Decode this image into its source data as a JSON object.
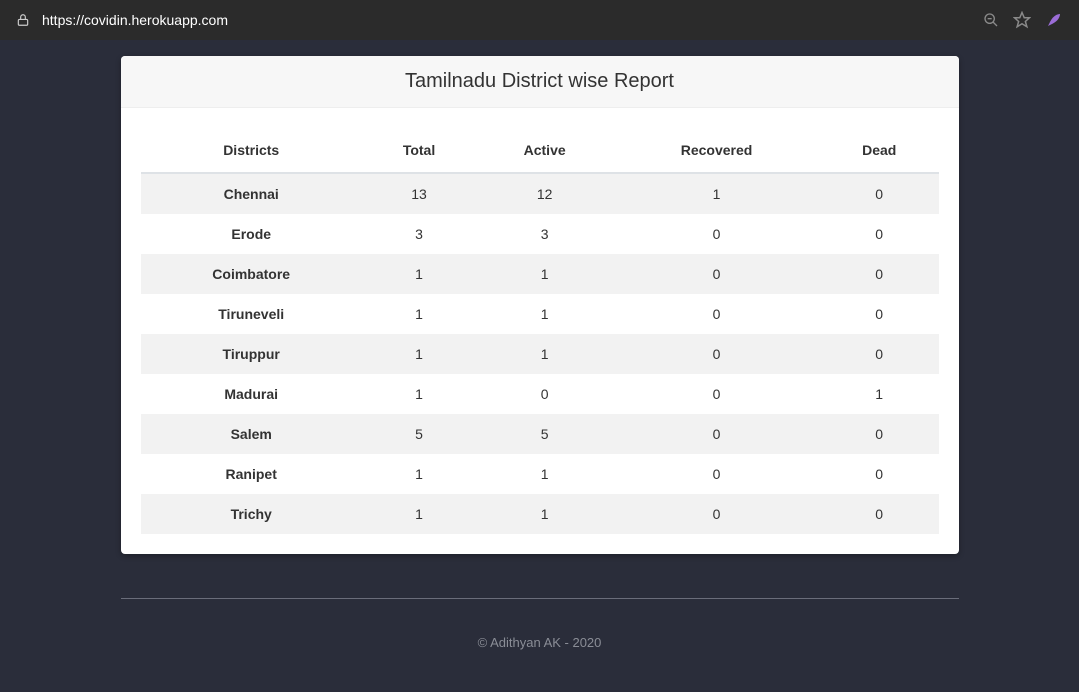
{
  "browser": {
    "url": "https://covidin.herokuapp.com"
  },
  "page": {
    "title": "Tamilnadu District wise Report",
    "headers": {
      "district": "Districts",
      "total": "Total",
      "active": "Active",
      "recovered": "Recovered",
      "dead": "Dead"
    },
    "rows": [
      {
        "district": "Chennai",
        "total": "13",
        "active": "12",
        "recovered": "1",
        "dead": "0"
      },
      {
        "district": "Erode",
        "total": "3",
        "active": "3",
        "recovered": "0",
        "dead": "0"
      },
      {
        "district": "Coimbatore",
        "total": "1",
        "active": "1",
        "recovered": "0",
        "dead": "0"
      },
      {
        "district": "Tiruneveli",
        "total": "1",
        "active": "1",
        "recovered": "0",
        "dead": "0"
      },
      {
        "district": "Tiruppur",
        "total": "1",
        "active": "1",
        "recovered": "0",
        "dead": "0"
      },
      {
        "district": "Madurai",
        "total": "1",
        "active": "0",
        "recovered": "0",
        "dead": "1"
      },
      {
        "district": "Salem",
        "total": "5",
        "active": "5",
        "recovered": "0",
        "dead": "0"
      },
      {
        "district": "Ranipet",
        "total": "1",
        "active": "1",
        "recovered": "0",
        "dead": "0"
      },
      {
        "district": "Trichy",
        "total": "1",
        "active": "1",
        "recovered": "0",
        "dead": "0"
      }
    ],
    "footer": "© Adithyan AK - 2020"
  }
}
